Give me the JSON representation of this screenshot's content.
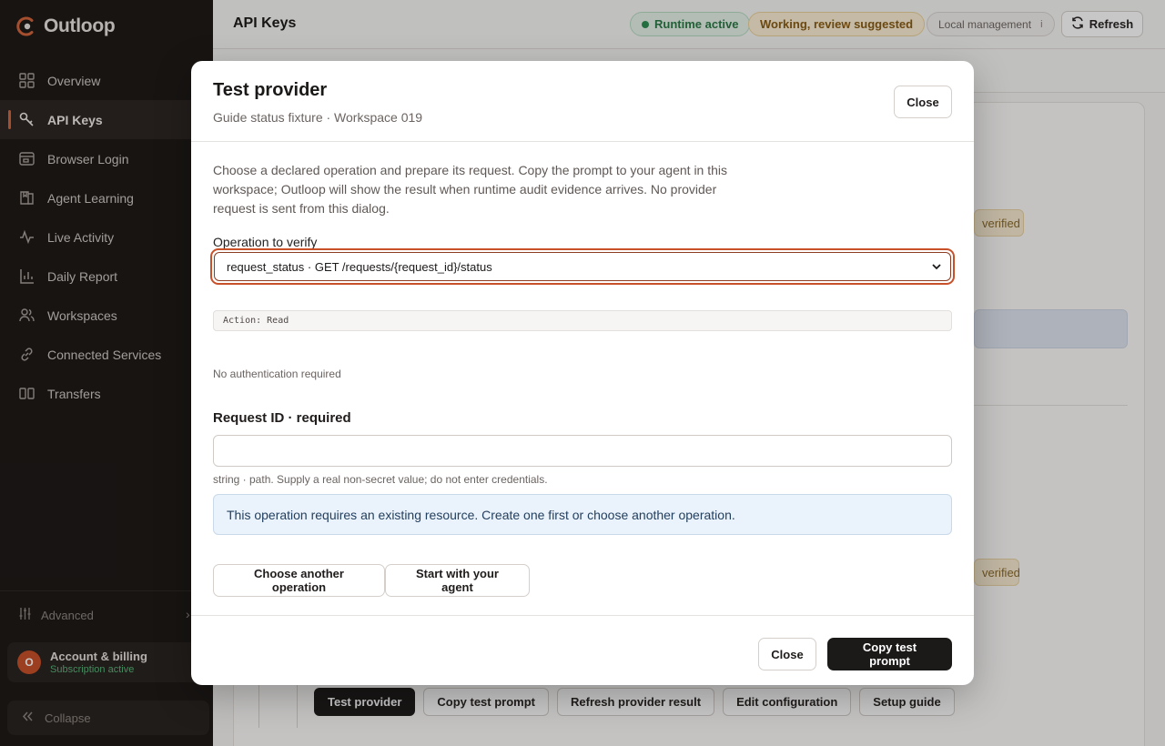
{
  "sidebar": {
    "brand": "Outloop",
    "items": [
      {
        "label": "Overview",
        "icon": "grid-icon"
      },
      {
        "label": "API Keys",
        "icon": "key-icon"
      },
      {
        "label": "Browser Login",
        "icon": "browser-icon"
      },
      {
        "label": "Agent Learning",
        "icon": "book-icon"
      },
      {
        "label": "Live Activity",
        "icon": "activity-icon"
      },
      {
        "label": "Daily Report",
        "icon": "bar-chart-icon"
      },
      {
        "label": "Workspaces",
        "icon": "users-icon"
      },
      {
        "label": "Connected Services",
        "icon": "link-icon"
      },
      {
        "label": "Transfers",
        "icon": "transfer-icon"
      }
    ],
    "active_item": "API Keys",
    "advanced_label": "Advanced",
    "account": {
      "avatar_initial": "O",
      "title": "Account & billing",
      "status": "Subscription active"
    },
    "collapse_label": "Collapse"
  },
  "header": {
    "title": "API Keys",
    "runtime_pill": "Runtime active",
    "working_pill": "Working, review suggested",
    "local_pill": "Local management",
    "refresh_label": "Refresh"
  },
  "background": {
    "badge_verified": "verified",
    "actions": [
      "Test provider",
      "Copy test prompt",
      "Refresh provider result",
      "Edit configuration",
      "Setup guide"
    ]
  },
  "dialog": {
    "title": "Test provider",
    "subtitle": "Guide status fixture · Workspace 019",
    "close_label": "Close",
    "intro": "Choose a declared operation and prepare its request. Copy the prompt to your agent in this workspace; Outloop will show the result when runtime audit evidence arrives. No provider request is sent from this dialog.",
    "operation_label": "Operation to verify",
    "operation_selected": "request_status · GET /requests/{request_id}/status",
    "action_chip": "Action: Read",
    "auth_note": "No authentication required",
    "field_label": "Request ID · required",
    "field_value": "",
    "field_help": "string · path. Supply a real non-secret value; do not enter credentials.",
    "info_message": "This operation requires an existing resource. Create one first or choose another operation.",
    "choose_another_label": "Choose another operation",
    "start_agent_label": "Start with your agent",
    "footer_close_label": "Close",
    "copy_prompt_label": "Copy test prompt"
  },
  "colors": {
    "accent": "#c8512a",
    "sidebar_bg": "#1e1a18",
    "primary_button": "#1c1a19",
    "info_bg": "#eaf2fb",
    "runtime_green": "#2f8f52",
    "warning_amber": "#8a5d15"
  }
}
